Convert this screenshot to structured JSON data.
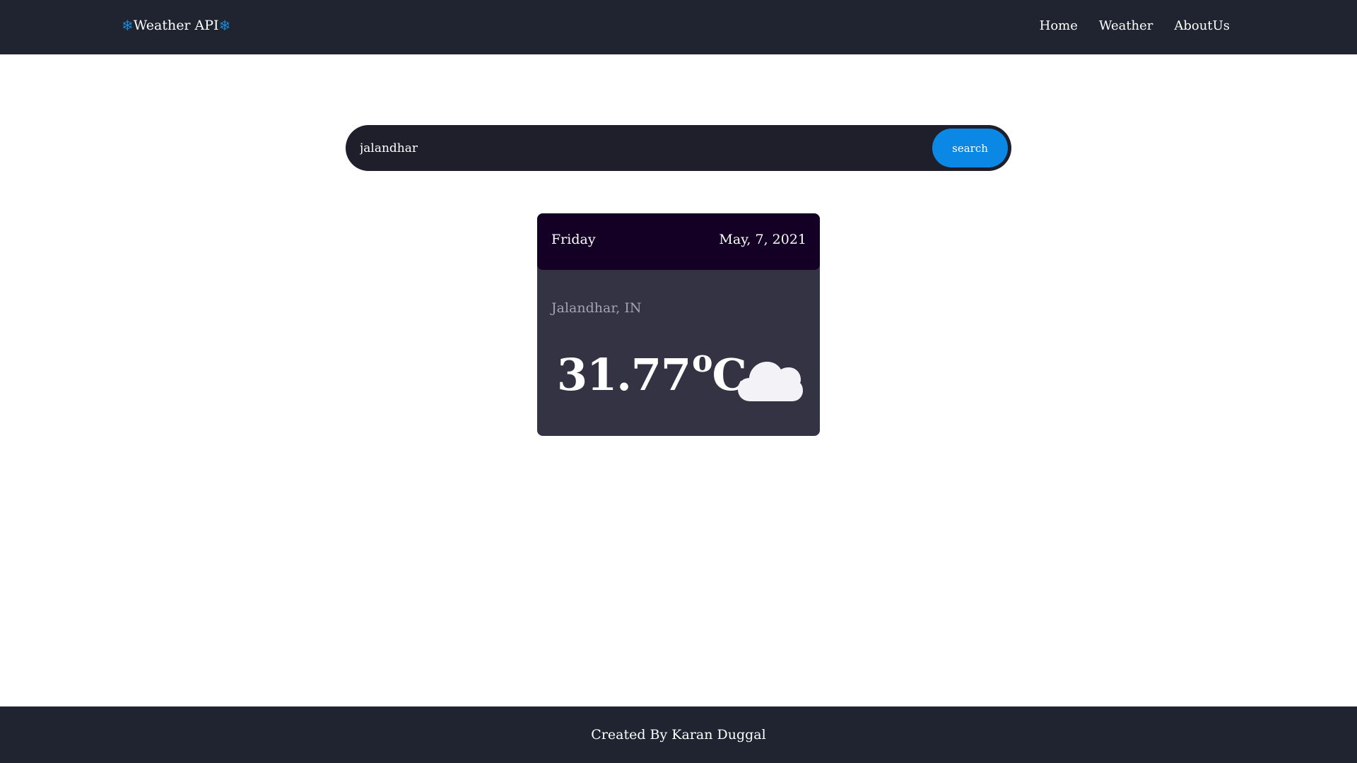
{
  "navbar": {
    "brand": "Weather API",
    "brand_icon": "snowflake-icon",
    "links": [
      "Home",
      "Weather",
      "AboutUs"
    ]
  },
  "search": {
    "value": "jalandhar",
    "button_label": "search"
  },
  "card": {
    "day": "Friday",
    "date": "May, 7, 2021",
    "location": "Jalandhar, IN",
    "temperature": "31.77",
    "degree_symbol": "o",
    "unit": "C",
    "condition_icon": "cloud-icon"
  },
  "footer": {
    "text": "Created By Karan Duggal"
  },
  "colors": {
    "navbar": "#1f2430",
    "accent": "#0b88e6",
    "card_body": "#333344",
    "card_header": "#140025"
  }
}
